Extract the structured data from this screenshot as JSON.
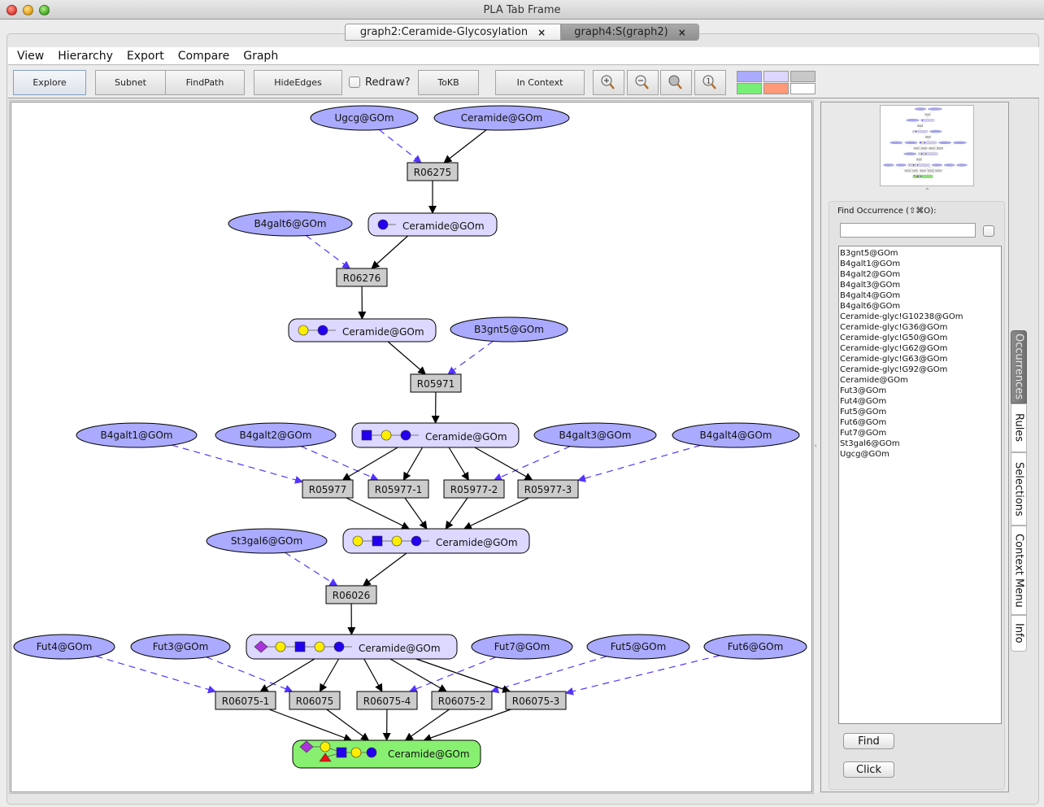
{
  "window": {
    "title": "PLA Tab Frame"
  },
  "tabs": [
    {
      "label": "graph2:Ceramide-Glycosylation",
      "close": "×",
      "active": false
    },
    {
      "label": "graph4:S(graph2)",
      "close": "×",
      "active": true
    }
  ],
  "menu": [
    "View",
    "Hierarchy",
    "Export",
    "Compare",
    "Graph"
  ],
  "toolbar": {
    "explore": "Explore",
    "subnet": "Subnet",
    "findpath": "FindPath",
    "hideedges": "HideEdges",
    "redraw_label": "Redraw?",
    "redraw_checked": false,
    "tokb": "ToKB",
    "in_context": "In Context",
    "zoom_buttons": [
      "zoom-in",
      "zoom-out",
      "zoom-fit",
      "zoom-reset-1"
    ],
    "color_swatches": [
      "#aaaaff",
      "#ddd6ff",
      "#c8c8c8",
      "#77ee77",
      "#ff9977",
      "#ffffff"
    ]
  },
  "colors": {
    "enzyme_fill": "#aaaaff",
    "compound_fill": "#dcd8ff",
    "reaction_fill": "#cccccc",
    "target_fill": "#88f070",
    "dashed_edge": "#5533ff",
    "solid_edge": "#000000"
  },
  "graph": {
    "enzymes": [
      {
        "id": "e_ugcg",
        "label": "Ugcg@GOm"
      },
      {
        "id": "e_cer",
        "label": "Ceramide@GOm"
      },
      {
        "id": "e_b4g6",
        "label": "B4galt6@GOm"
      },
      {
        "id": "e_b3g5",
        "label": "B3gnt5@GOm"
      },
      {
        "id": "e_b4g1",
        "label": "B4galt1@GOm"
      },
      {
        "id": "e_b4g2",
        "label": "B4galt2@GOm"
      },
      {
        "id": "e_b4g3",
        "label": "B4galt3@GOm"
      },
      {
        "id": "e_b4g4",
        "label": "B4galt4@GOm"
      },
      {
        "id": "e_st3",
        "label": "St3gal6@GOm"
      },
      {
        "id": "e_fut4",
        "label": "Fut4@GOm"
      },
      {
        "id": "e_fut3",
        "label": "Fut3@GOm"
      },
      {
        "id": "e_fut7",
        "label": "Fut7@GOm"
      },
      {
        "id": "e_fut5",
        "label": "Fut5@GOm"
      },
      {
        "id": "e_fut6",
        "label": "Fut6@GOm"
      }
    ],
    "reactions": [
      "R06275",
      "R06276",
      "R05971",
      "R05977",
      "R05977-1",
      "R05977-2",
      "R05977-3",
      "R06026",
      "R06075-1",
      "R06075",
      "R06075-4",
      "R06075-2",
      "R06075-3"
    ],
    "compounds": [
      {
        "id": "c1",
        "label": "Ceramide@GOm",
        "glycan": [
          "blue-circle"
        ]
      },
      {
        "id": "c2",
        "label": "Ceramide@GOm",
        "glycan": [
          "yellow-circle",
          "blue-circle"
        ]
      },
      {
        "id": "c3",
        "label": "Ceramide@GOm",
        "glycan": [
          "blue-square",
          "yellow-circle",
          "blue-circle"
        ]
      },
      {
        "id": "c4",
        "label": "Ceramide@GOm",
        "glycan": [
          "yellow-circle",
          "blue-square",
          "yellow-circle",
          "blue-circle"
        ]
      },
      {
        "id": "c5",
        "label": "Ceramide@GOm",
        "glycan": [
          "purple-diamond",
          "yellow-circle",
          "blue-square",
          "yellow-circle",
          "blue-circle"
        ]
      },
      {
        "id": "c6",
        "label": "Ceramide@GOm",
        "glycan": [
          "purple-diamond",
          "yellow-circle",
          "red-triangle",
          "blue-square",
          "yellow-circle",
          "blue-circle"
        ],
        "highlighted": true
      }
    ],
    "edges": [
      {
        "from": "Ugcg@GOm",
        "to": "R06275",
        "type": "dashed"
      },
      {
        "from": "Ceramide@GOm",
        "to": "R06275",
        "type": "solid"
      },
      {
        "from": "R06275",
        "to": "c1",
        "type": "solid"
      },
      {
        "from": "B4galt6@GOm",
        "to": "R06276",
        "type": "dashed"
      },
      {
        "from": "c1",
        "to": "R06276",
        "type": "solid"
      },
      {
        "from": "R06276",
        "to": "c2",
        "type": "solid"
      },
      {
        "from": "c2",
        "to": "R05971",
        "type": "solid"
      },
      {
        "from": "B3gnt5@GOm",
        "to": "R05971",
        "type": "dashed"
      },
      {
        "from": "R05971",
        "to": "c3",
        "type": "solid"
      },
      {
        "from": "B4galt1@GOm",
        "to": "R05977",
        "type": "dashed"
      },
      {
        "from": "B4galt2@GOm",
        "to": "R05977-1",
        "type": "dashed"
      },
      {
        "from": "B4galt3@GOm",
        "to": "R05977-2",
        "type": "dashed"
      },
      {
        "from": "B4galt4@GOm",
        "to": "R05977-3",
        "type": "dashed"
      },
      {
        "from": "c3",
        "to": "R05977",
        "type": "solid"
      },
      {
        "from": "c3",
        "to": "R05977-1",
        "type": "solid"
      },
      {
        "from": "c3",
        "to": "R05977-2",
        "type": "solid"
      },
      {
        "from": "c3",
        "to": "R05977-3",
        "type": "solid"
      },
      {
        "from": "R05977",
        "to": "c4",
        "type": "solid"
      },
      {
        "from": "R05977-1",
        "to": "c4",
        "type": "solid"
      },
      {
        "from": "R05977-2",
        "to": "c4",
        "type": "solid"
      },
      {
        "from": "R05977-3",
        "to": "c4",
        "type": "solid"
      },
      {
        "from": "St3gal6@GOm",
        "to": "R06026",
        "type": "dashed"
      },
      {
        "from": "c4",
        "to": "R06026",
        "type": "solid"
      },
      {
        "from": "R06026",
        "to": "c5",
        "type": "solid"
      },
      {
        "from": "Fut4@GOm",
        "to": "R06075-1",
        "type": "dashed"
      },
      {
        "from": "Fut3@GOm",
        "to": "R06075",
        "type": "dashed"
      },
      {
        "from": "Fut7@GOm",
        "to": "R06075-4",
        "type": "dashed"
      },
      {
        "from": "Fut5@GOm",
        "to": "R06075-2",
        "type": "dashed"
      },
      {
        "from": "Fut6@GOm",
        "to": "R06075-3",
        "type": "dashed"
      },
      {
        "from": "c5",
        "to": "R06075-1",
        "type": "solid"
      },
      {
        "from": "c5",
        "to": "R06075",
        "type": "solid"
      },
      {
        "from": "c5",
        "to": "R06075-4",
        "type": "solid"
      },
      {
        "from": "c5",
        "to": "R06075-2",
        "type": "solid"
      },
      {
        "from": "c5",
        "to": "R06075-3",
        "type": "solid"
      },
      {
        "from": "R06075-1",
        "to": "c6",
        "type": "solid"
      },
      {
        "from": "R06075",
        "to": "c6",
        "type": "solid"
      },
      {
        "from": "R06075-4",
        "to": "c6",
        "type": "solid"
      },
      {
        "from": "R06075-2",
        "to": "c6",
        "type": "solid"
      },
      {
        "from": "R06075-3",
        "to": "c6",
        "type": "solid"
      }
    ]
  },
  "right_panel": {
    "find_title": "Find Occurrence (⇧⌘O):",
    "find_value": "",
    "occurrences": [
      "B3gnt5@GOm",
      "B4galt1@GOm",
      "B4galt2@GOm",
      "B4galt3@GOm",
      "B4galt4@GOm",
      "B4galt6@GOm",
      "Ceramide-glyc!G10238@GOm",
      "Ceramide-glyc!G36@GOm",
      "Ceramide-glyc!G50@GOm",
      "Ceramide-glyc!G62@GOm",
      "Ceramide-glyc!G63@GOm",
      "Ceramide-glyc!G92@GOm",
      "Ceramide@GOm",
      "Fut3@GOm",
      "Fut4@GOm",
      "Fut5@GOm",
      "Fut6@GOm",
      "Fut7@GOm",
      "St3gal6@GOm",
      "Ugcg@GOm"
    ],
    "find_button": "Find",
    "click_button": "Click"
  },
  "side_tabs": [
    {
      "label": "Occurrences",
      "active": true
    },
    {
      "label": "Rules",
      "active": false
    },
    {
      "label": "Selections",
      "active": false
    },
    {
      "label": "Context Menu",
      "active": false
    },
    {
      "label": "Info",
      "active": false
    }
  ]
}
